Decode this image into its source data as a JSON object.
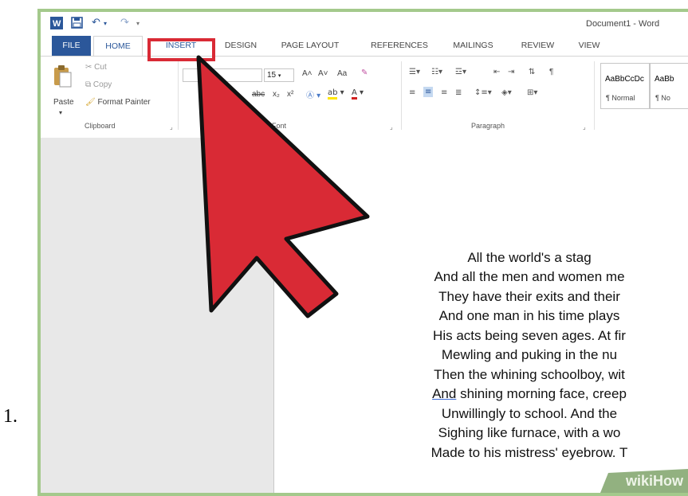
{
  "step": {
    "number": "1."
  },
  "title_bar": {
    "document_title": "Document1 - Word",
    "qat": {
      "save": "save-icon",
      "undo": "undo-icon",
      "redo": "redo-icon",
      "customize": "customize-icon"
    }
  },
  "tabs": [
    "FILE",
    "HOME",
    "INSERT",
    "DESIGN",
    "PAGE LAYOUT",
    "REFERENCES",
    "MAILINGS",
    "REVIEW",
    "VIEW"
  ],
  "ribbon": {
    "clipboard": {
      "paste": "Paste",
      "cut": "Cut",
      "copy": "Copy",
      "format_painter": "Format Painter",
      "label": "Clipboard"
    },
    "font": {
      "size": "15",
      "grow": "A˄",
      "shrink": "A˅",
      "change_case": "Aa",
      "strikethrough": "abc",
      "subscript": "x₂",
      "superscript": "x²",
      "label": "Font"
    },
    "paragraph": {
      "label": "Paragraph",
      "pilcrow": "¶"
    },
    "styles": [
      {
        "preview": "AaBbCcDc",
        "name": "¶ Normal"
      },
      {
        "preview": "AaBb",
        "name": "¶ No"
      }
    ]
  },
  "document": {
    "lines": [
      "All the world's a stag",
      "And all the men and women me",
      "They have their exits and their",
      "And one man in his time plays",
      "His acts being seven ages. At fir",
      "Mewling and puking in the nu",
      "Then the whining schoolboy, wit",
      "And shining morning face, creep",
      "Unwillingly to school. And the",
      "Sighing like furnace, with a wo",
      "Made to his mistress' eyebrow. T"
    ],
    "underlined_word": "And"
  },
  "watermark": {
    "text": "wikiHow"
  },
  "colors": {
    "word_blue": "#2b579a",
    "highlight_red": "#d92a35",
    "frame_green": "#a4c98c"
  }
}
